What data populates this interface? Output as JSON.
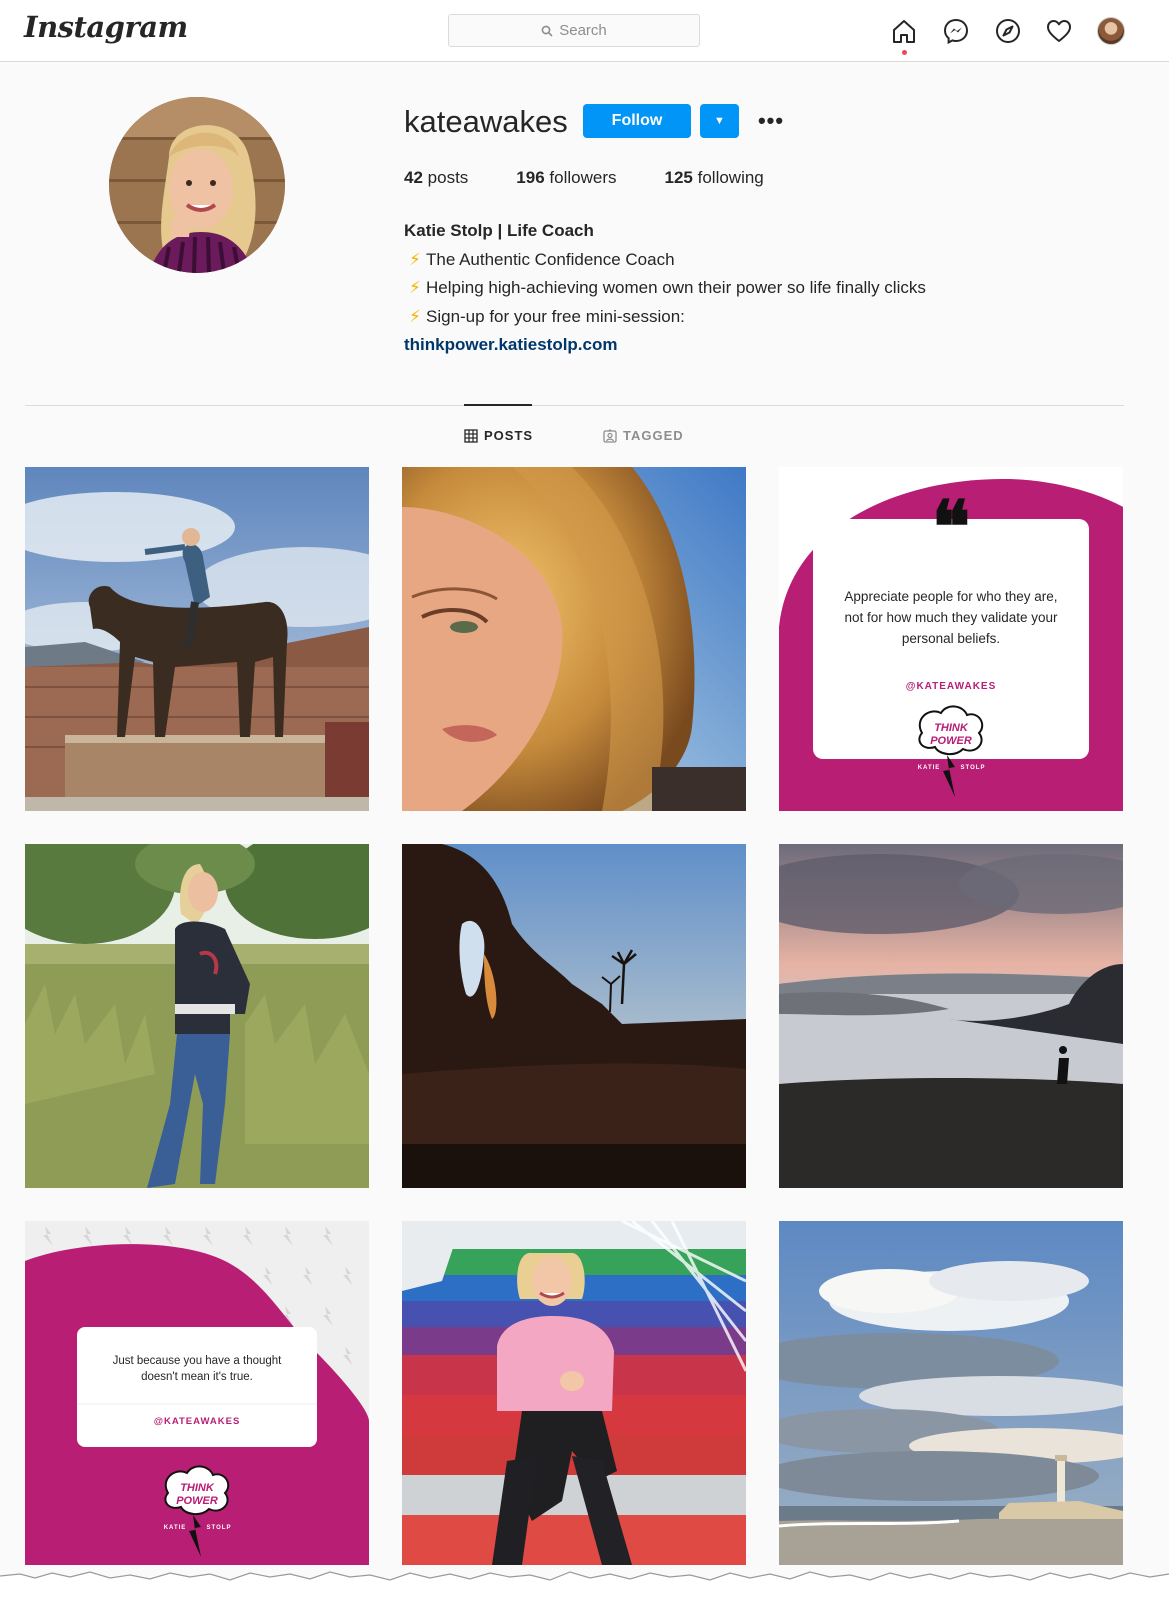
{
  "header": {
    "logo": "Instagram",
    "search_placeholder": "Search"
  },
  "profile": {
    "username": "kateawakes",
    "follow_label": "Follow",
    "stats": {
      "posts_count": "42",
      "posts_label": "posts",
      "followers_count": "196",
      "followers_label": "followers",
      "following_count": "125",
      "following_label": "following"
    },
    "bio": {
      "name": "Katie Stolp | Life Coach",
      "lines": [
        "The Authentic Confidence Coach",
        "Helping high-achieving women own their power so life finally clicks",
        "Sign-up for your free mini-session:"
      ],
      "bolt": "⚡",
      "link": "thinkpower.katiestolp.com"
    }
  },
  "tabs": [
    {
      "label": "POSTS",
      "active": true
    },
    {
      "label": "TAGGED",
      "active": false
    }
  ],
  "posts": {
    "quote1": {
      "text_lines": [
        "Appreciate people for who they are,",
        "not for how much they validate your",
        "personal beliefs."
      ],
      "handle": "@KATEAWAKES",
      "badge_line1": "THINK",
      "badge_line2": "POWER",
      "brand_left": "KATIE",
      "brand_right": "STOLP"
    },
    "quote2": {
      "text_lines": [
        "Just because you have a thought",
        "doesn't mean it's true."
      ],
      "handle": "@KATEAWAKES",
      "badge_line1": "THINK",
      "badge_line2": "POWER",
      "brand_left": "KATIE",
      "brand_right": "STOLP"
    }
  },
  "colors": {
    "accent": "#0095f6",
    "brand_magenta": "#b81e74",
    "link": "#00376b"
  }
}
